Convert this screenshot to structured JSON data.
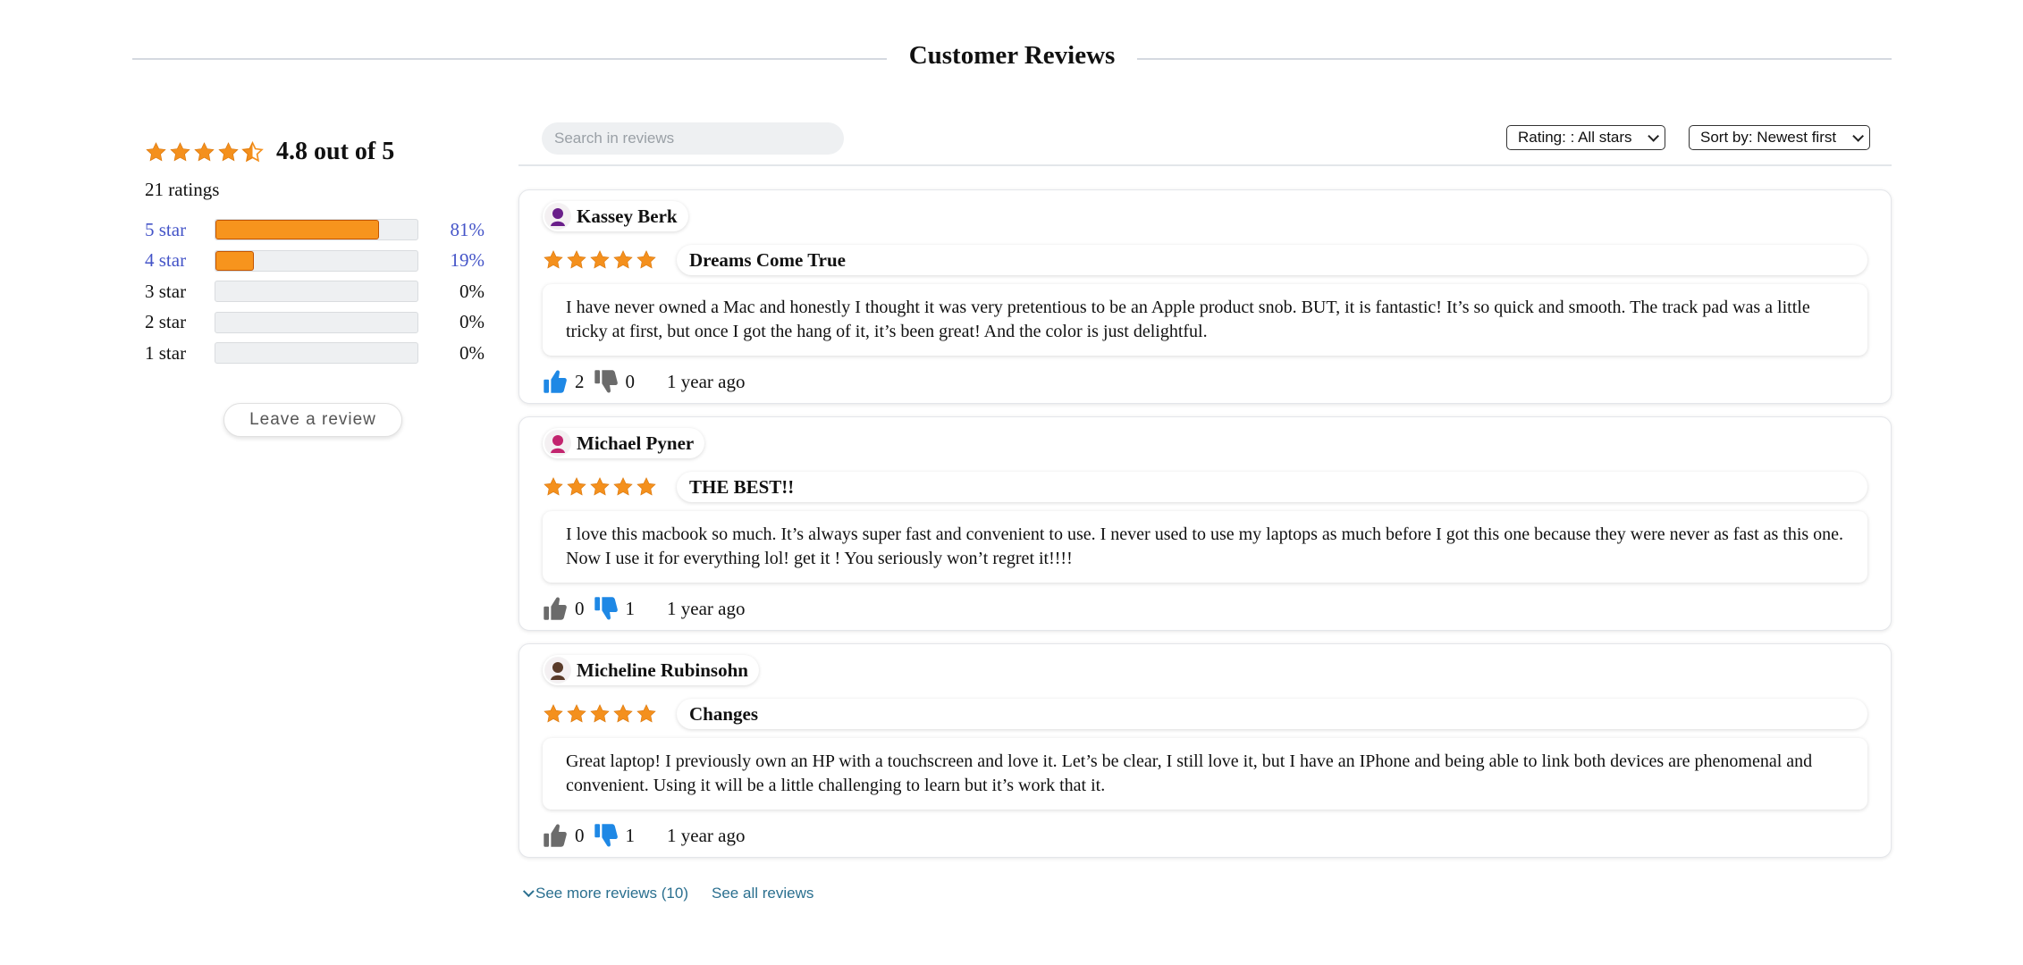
{
  "header": {
    "title": "Customer Reviews"
  },
  "summary": {
    "average_rating": 4.5,
    "average_text": "4.8 out of 5",
    "ratings_count": "21 ratings",
    "histogram": [
      {
        "label": "5 star",
        "percent_text": "81%",
        "fraction": 0.81,
        "link": true
      },
      {
        "label": "4 star",
        "percent_text": "19%",
        "fraction": 0.19,
        "link": true
      },
      {
        "label": "3 star",
        "percent_text": "0%",
        "fraction": 0,
        "link": false
      },
      {
        "label": "2 star",
        "percent_text": "0%",
        "fraction": 0,
        "link": false
      },
      {
        "label": "1 star",
        "percent_text": "0%",
        "fraction": 0,
        "link": false
      }
    ],
    "leave_review_label": "Leave a review"
  },
  "toolbar": {
    "search_placeholder": "Search in reviews",
    "rating_filter": "Rating: : All stars",
    "sort": "Sort by: Newest first"
  },
  "reviews": [
    {
      "author": "Kassey Berk",
      "stars": 5,
      "title": "Dreams Come True",
      "body": "I have never owned a Mac and honestly I thought it was very pretentious to be an Apple product snob. BUT, it is fantastic! It’s so quick and smooth. The track pad was a little tricky at first, but once I got the hang of it, it’s been great! And the color is just delightful.",
      "likes": "2",
      "dislikes": "0",
      "time": "1 year ago",
      "liked": true,
      "disliked": false,
      "avatar_color": "#6a1f8a"
    },
    {
      "author": "Michael Pyner",
      "stars": 5,
      "title": "THE BEST!!",
      "body": "I love this macbook so much. It’s always super fast and convenient to use. I never used to use my laptops as much before I got this one because they were never as fast as this one. Now I use it for everything lol! get it ! You seriously won’t regret it!!!!",
      "likes": "0",
      "dislikes": "1",
      "time": "1 year ago",
      "liked": false,
      "disliked": true,
      "avatar_color": "#c2246e"
    },
    {
      "author": "Micheline Rubinsohn",
      "stars": 5,
      "title": "Changes",
      "body": "Great laptop! I previously own an HP with a touchscreen and love it. Let’s be clear, I still love it, but I have an IPhone and being able to link both devices are phenomenal and convenient. Using it will be a little challenging to learn but it’s work that it.",
      "likes": "0",
      "dislikes": "1",
      "time": "1 year ago",
      "liked": false,
      "disliked": true,
      "avatar_color": "#5a3b2a"
    }
  ],
  "footer": {
    "see_more": "See more reviews (10)",
    "see_all": "See all reviews"
  },
  "colors": {
    "star": "#f4901d",
    "bar_fill": "#f7941d",
    "link": "#4454c8",
    "thumb_active": "#1e88e5",
    "thumb_inactive": "#6b6b6b"
  },
  "icons": {
    "star": "star-icon",
    "half_star": "half-star-icon",
    "thumb_up": "thumb-up-icon",
    "thumb_down": "thumb-down-icon",
    "avatar": "avatar-icon",
    "chevron": "chevron-down-icon"
  }
}
